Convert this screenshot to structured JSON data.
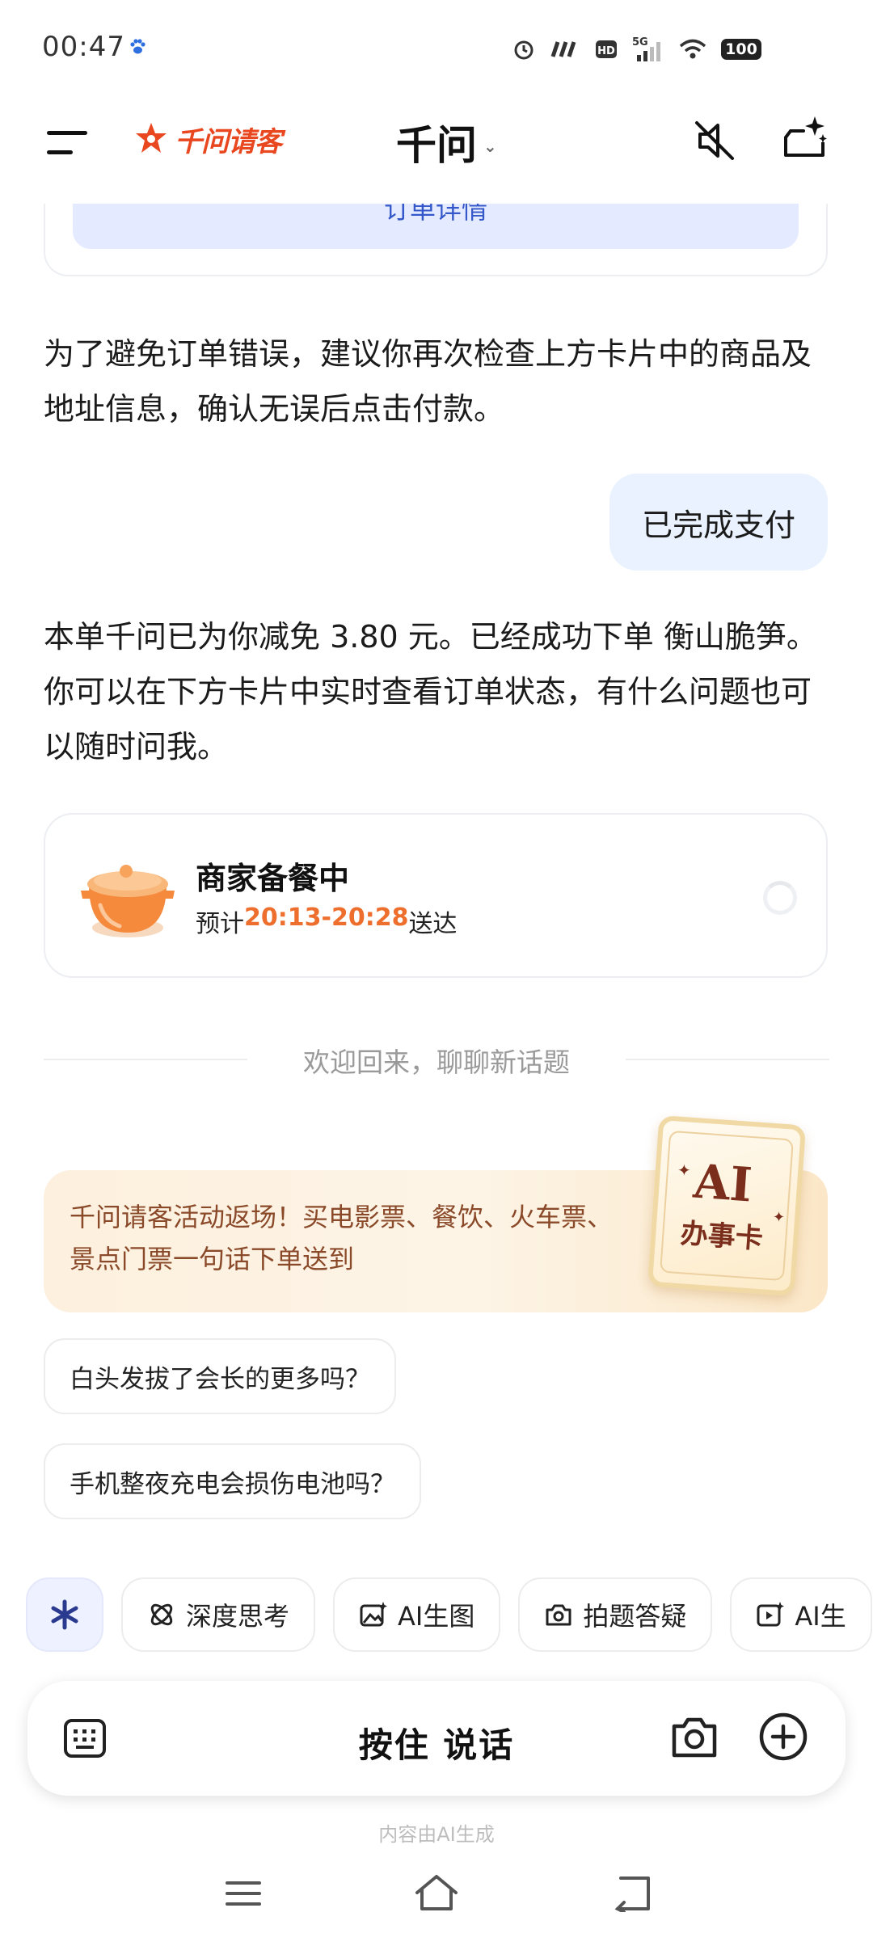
{
  "status_bar": {
    "time": "00:47",
    "battery": "100",
    "network": "5G"
  },
  "header": {
    "brand": "千问请客",
    "title": "千问",
    "title_caret": "⌄"
  },
  "order_card": {
    "detail_button": "订单详情"
  },
  "messages": {
    "assistant_1": "为了避免订单错误，建议你再次检查上方卡片中的商品及地址信息，确认无误后点击付款。",
    "user_1": "已完成支付",
    "assistant_2": "本单千问已为你减免 3.80 元。已经成功下单 衡山脆笋。你可以在下方卡片中实时查看订单状态，有什么问题也可以随时问我。"
  },
  "status_card": {
    "title": "商家备餐中",
    "eta_prefix": "预计",
    "eta_time": "20:13-20:28",
    "eta_suffix": "送达"
  },
  "divider": {
    "text": "欢迎回来，聊聊新话题"
  },
  "promo": {
    "text": "千问请客活动返场！买电影票、餐饮、火车票、景点门票一句话下单送到",
    "badge_main": "AI",
    "badge_sub": "办事卡"
  },
  "suggestions": [
    "白头发拔了会长的更多吗？",
    "手机整夜充电会损伤电池吗？"
  ],
  "tools": [
    {
      "label": "深度思考",
      "icon": "deep-think-icon"
    },
    {
      "label": "AI生图",
      "icon": "image-gen-icon"
    },
    {
      "label": "拍题答疑",
      "icon": "camera-question-icon"
    },
    {
      "label": "AI生",
      "icon": "ai-video-icon"
    }
  ],
  "input": {
    "talk_label": "按住 说话",
    "disclaimer": "内容由AI生成"
  },
  "colors": {
    "brand": "#e8471f",
    "accent_orange": "#ee6f2d",
    "user_bubble": "#e9f2fe",
    "promo_text": "#8a4a2a"
  }
}
